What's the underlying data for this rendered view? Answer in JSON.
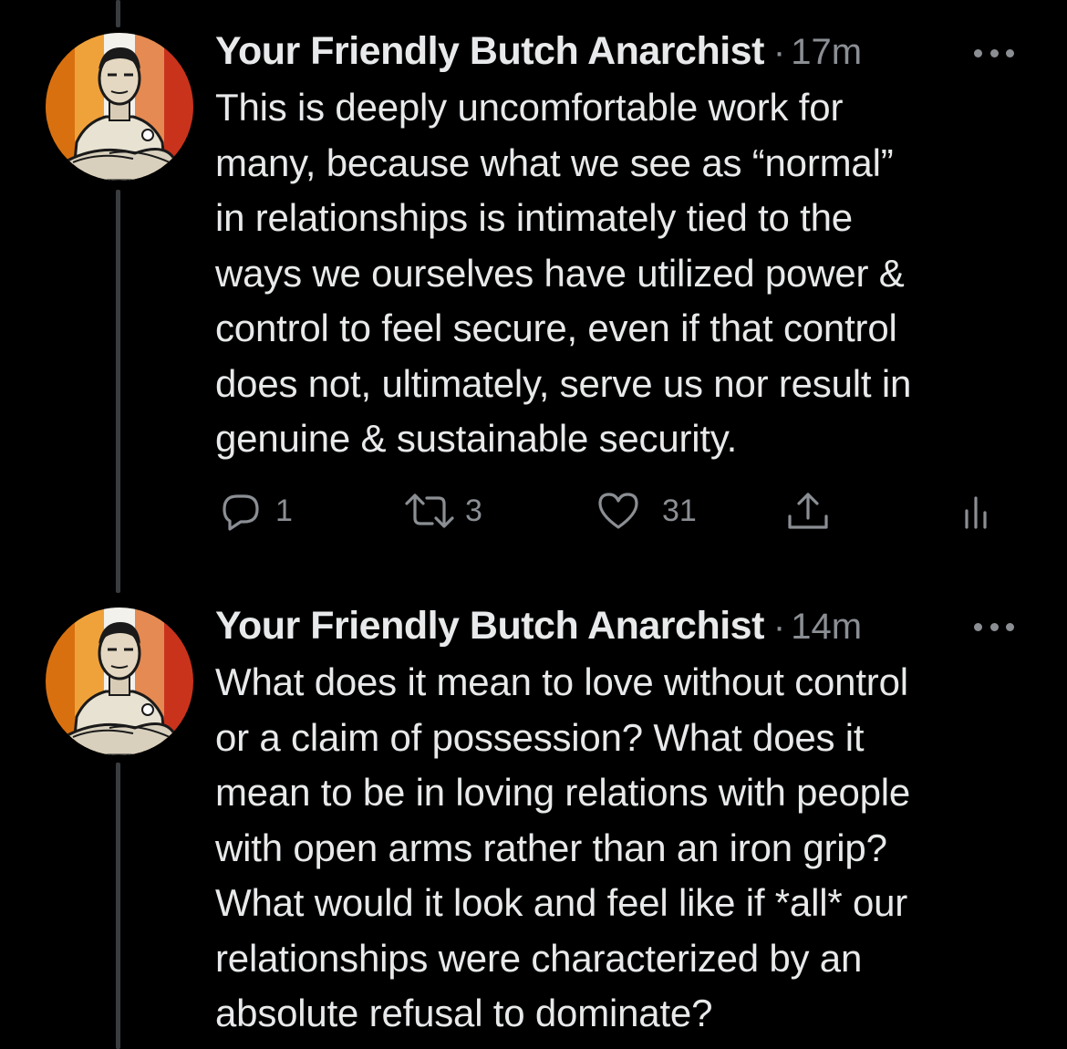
{
  "colors": {
    "background": "#000000",
    "text": "#e7e9ea",
    "secondary": "#8b8f94",
    "thread_line": "#3a3d40"
  },
  "tweets": [
    {
      "author": "Your Friendly Butch Anarchist",
      "separator": "·",
      "time": "17m",
      "text": "This is deeply uncomfortable work for\nmany, because what we see as “normal”\nin relationships is intimately tied to the\nways we ourselves have utilized power &\ncontrol to feel secure, even if that control\ndoes not, ultimately, serve us nor result in\ngenuine & sustainable security.",
      "actions": {
        "reply_icon": "reply-icon",
        "reply_count": "1",
        "retweet_icon": "retweet-icon",
        "retweet_count": "3",
        "like_icon": "heart-icon",
        "like_count": "31",
        "share_icon": "share-icon",
        "analytics_icon": "analytics-icon"
      }
    },
    {
      "author": "Your Friendly Butch Anarchist",
      "separator": "·",
      "time": "14m",
      "text": "What does it mean to love without control\nor a claim of possession? What does it\nmean to be in loving relations with people\nwith open arms rather than an iron grip?\nWhat would it look and feel like if *all* our\nrelationships were characterized by an\nabsolute refusal to dominate?"
    }
  ]
}
